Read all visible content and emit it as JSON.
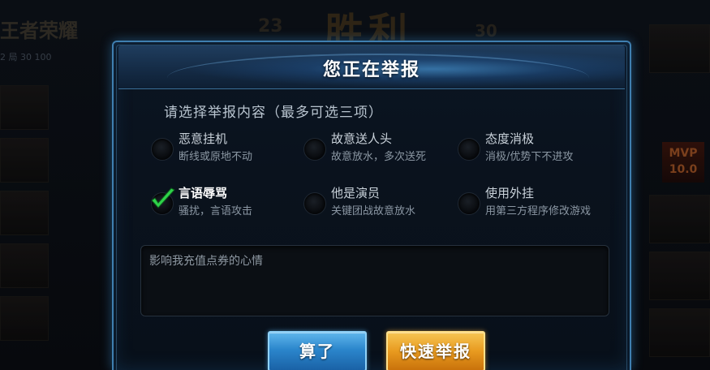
{
  "background": {
    "top_left_title": "王者荣耀",
    "top_left_small": "2  局  30  100",
    "banner_left": "23",
    "banner": "胜利",
    "banner_right": "30",
    "mvp_label": "MVP",
    "mvp_value": "10.0"
  },
  "dialog": {
    "title": "您正在举报",
    "subtitle": "请选择举报内容（最多可选三项）",
    "options": [
      {
        "label": "恶意挂机",
        "desc": "断线或原地不动",
        "selected": false
      },
      {
        "label": "故意送人头",
        "desc": "故意放水，多次送死",
        "selected": false
      },
      {
        "label": "态度消极",
        "desc": "消极/优势下不进攻",
        "selected": false
      },
      {
        "label": "言语辱骂",
        "desc": "骚扰，言语攻击",
        "selected": true
      },
      {
        "label": "他是演员",
        "desc": "关键团战故意放水",
        "selected": false
      },
      {
        "label": "使用外挂",
        "desc": "用第三方程序修改游戏",
        "selected": false
      }
    ],
    "comment_value": "影响我充值点券的心情",
    "cancel_label": "算了",
    "report_label": "快速举报"
  },
  "colors": {
    "border_blue": "#3f7fb0",
    "check_green": "#2fd24a",
    "cancel_blue": "#2b86cc",
    "report_orange": "#e89a1f"
  }
}
